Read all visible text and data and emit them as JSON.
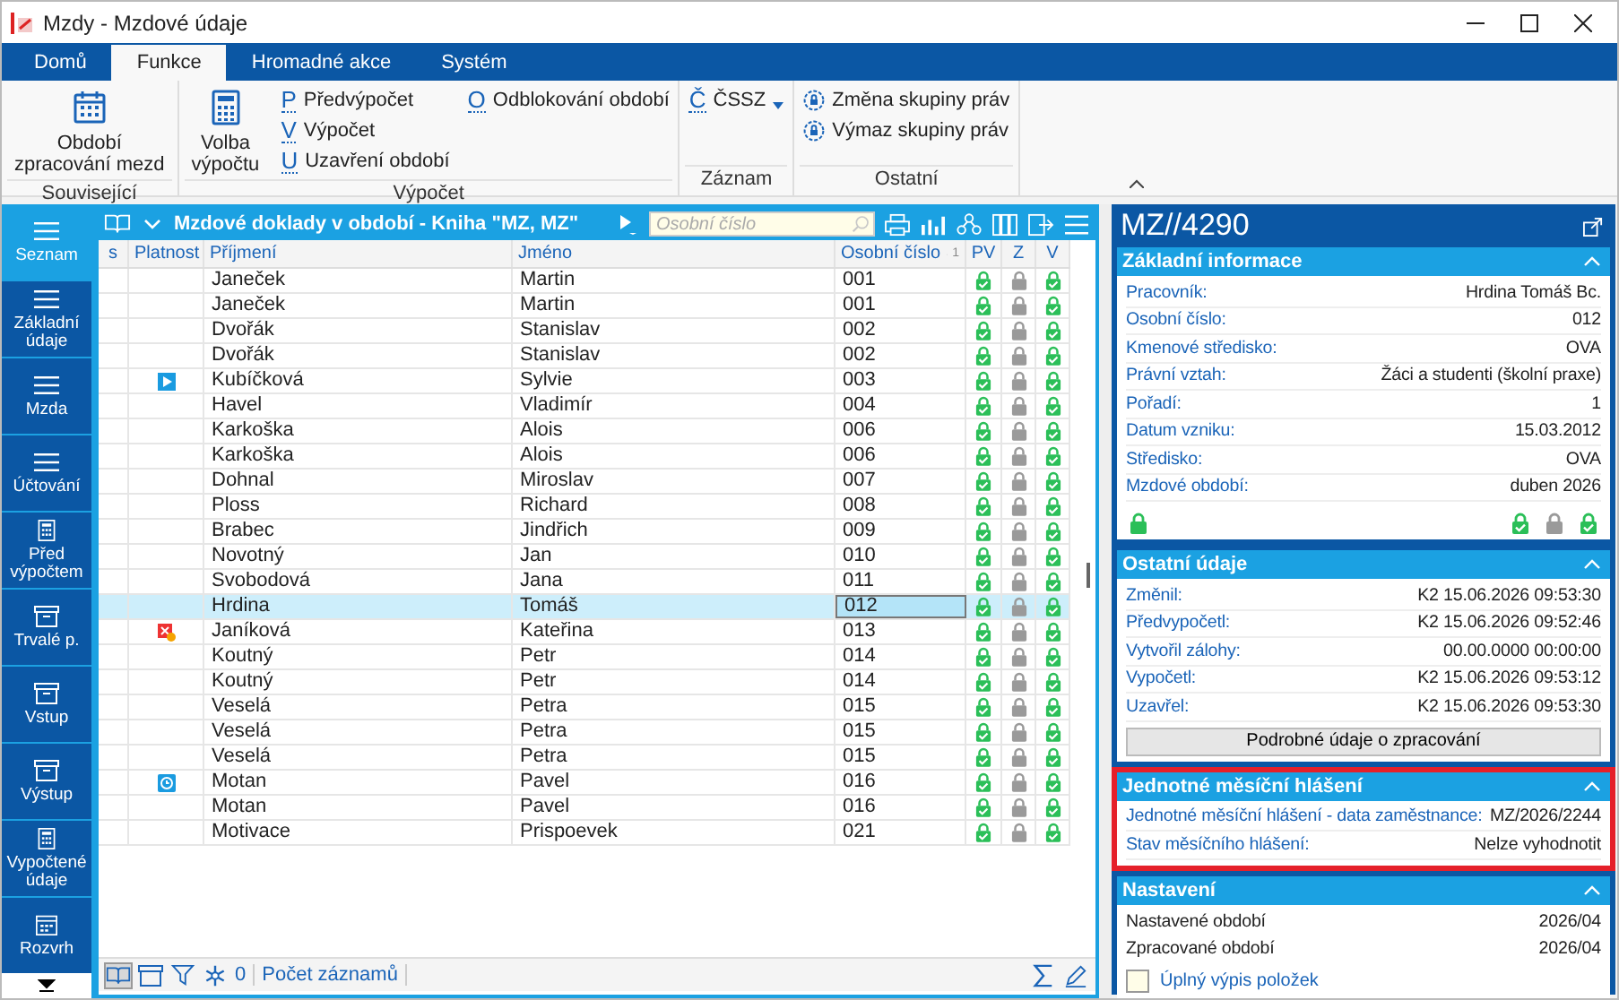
{
  "window": {
    "title": "Mzdy - Mzdové údaje"
  },
  "ribbon": {
    "tabs": [
      {
        "label": "Domů",
        "selected": false
      },
      {
        "label": "Funkce",
        "selected": true
      },
      {
        "label": "Hromadné akce",
        "selected": false
      },
      {
        "label": "Systém",
        "selected": false
      }
    ],
    "groups": [
      {
        "label": "Související",
        "columns": [
          [
            {
              "kind": "calendar",
              "lines": [
                "Období",
                "zpracování mezd"
              ]
            }
          ]
        ]
      },
      {
        "label": "Výpočet",
        "columns": [
          [
            {
              "kind": "calculator",
              "lines": [
                "Volba",
                "výpočtu"
              ]
            }
          ],
          [
            {
              "kind": "letter",
              "key": "P",
              "label": "Předvýpočet"
            },
            {
              "kind": "letter",
              "key": "V",
              "label": "Výpočet"
            },
            {
              "kind": "letter",
              "key": "U",
              "label": "Uzavření období"
            }
          ],
          [
            {
              "kind": "letter",
              "key": "O",
              "label": "Odblokování období"
            }
          ]
        ]
      },
      {
        "label": "Záznam",
        "columns": [
          [
            {
              "kind": "dropdown",
              "key": "Č",
              "label": "ČSSZ"
            }
          ]
        ]
      },
      {
        "label": "Ostatní",
        "columns": [
          [
            {
              "kind": "rights",
              "label": "Změna skupiny práv"
            },
            {
              "kind": "rights",
              "label": "Výmaz skupiny práv"
            }
          ]
        ]
      }
    ]
  },
  "nav": [
    {
      "label": "Seznam",
      "kind": "list",
      "selected": true
    },
    {
      "label": "Základní údaje",
      "kind": "list",
      "selected": false
    },
    {
      "label": "Mzda",
      "kind": "list",
      "selected": false
    },
    {
      "label": "Účtování",
      "kind": "list",
      "selected": false
    },
    {
      "label": "Před výpočtem",
      "kind": "calculator",
      "selected": false
    },
    {
      "label": "Trvalé p.",
      "kind": "box",
      "selected": false
    },
    {
      "label": "Vstup",
      "kind": "box",
      "selected": false
    },
    {
      "label": "Výstup",
      "kind": "box",
      "selected": false
    },
    {
      "label": "Vypočtené údaje",
      "kind": "calculator",
      "selected": false
    },
    {
      "label": "Rozvrh",
      "kind": "calendar",
      "selected": false
    }
  ],
  "table": {
    "title": "Mzdové doklady v období - Kniha \"MZ, MZ\"",
    "search": {
      "placeholder": "Osobní číslo"
    },
    "columns": [
      {
        "label": "s"
      },
      {
        "label": "Platnost"
      },
      {
        "label": "Příjmení"
      },
      {
        "label": "Jméno"
      },
      {
        "label": "Osobní číslo",
        "sort_index": "1"
      },
      {
        "label": "PV"
      },
      {
        "label": "Z"
      },
      {
        "label": "V"
      }
    ],
    "rows": [
      {
        "surname": "Janeček",
        "name": "Martin",
        "number": "001",
        "pv": true,
        "z": false,
        "v": true,
        "selected": false
      },
      {
        "surname": "Janeček",
        "name": "Martin",
        "number": "001",
        "pv": true,
        "z": false,
        "v": true,
        "selected": false
      },
      {
        "surname": "Dvořák",
        "name": "Stanislav",
        "number": "002",
        "pv": true,
        "z": false,
        "v": true,
        "selected": false
      },
      {
        "surname": "Dvořák",
        "name": "Stanislav",
        "number": "002",
        "pv": true,
        "z": false,
        "v": true,
        "selected": false
      },
      {
        "kind": "play",
        "surname": "Kubíčková",
        "name": "Sylvie",
        "number": "003",
        "pv": true,
        "z": false,
        "v": true,
        "selected": false
      },
      {
        "surname": "Havel",
        "name": "Vladimír",
        "number": "004",
        "pv": true,
        "z": false,
        "v": true,
        "selected": false
      },
      {
        "surname": "Karkoška",
        "name": "Alois",
        "number": "006",
        "pv": true,
        "z": false,
        "v": true,
        "selected": false
      },
      {
        "surname": "Karkoška",
        "name": "Alois",
        "number": "006",
        "pv": true,
        "z": false,
        "v": true,
        "selected": false
      },
      {
        "surname": "Dohnal",
        "name": "Miroslav",
        "number": "007",
        "pv": true,
        "z": false,
        "v": true,
        "selected": false
      },
      {
        "surname": "Ploss",
        "name": "Richard",
        "number": "008",
        "pv": true,
        "z": false,
        "v": true,
        "selected": false
      },
      {
        "surname": "Brabec",
        "name": "Jindřich",
        "number": "009",
        "pv": true,
        "z": false,
        "v": true,
        "selected": false
      },
      {
        "surname": "Novotný",
        "name": "Jan",
        "number": "010",
        "pv": true,
        "z": false,
        "v": true,
        "selected": false
      },
      {
        "surname": "Svobodová",
        "name": "Jana",
        "number": "011",
        "pv": true,
        "z": false,
        "v": true,
        "selected": false
      },
      {
        "surname": "Hrdina",
        "name": "Tomáš",
        "number": "012",
        "pv": true,
        "z": false,
        "v": true,
        "selected": true
      },
      {
        "kind": "error",
        "surname": "Janíková",
        "name": "Kateřina",
        "number": "013",
        "pv": true,
        "z": false,
        "v": true,
        "selected": false
      },
      {
        "surname": "Koutný",
        "name": "Petr",
        "number": "014",
        "pv": true,
        "z": false,
        "v": true,
        "selected": false
      },
      {
        "surname": "Koutný",
        "name": "Petr",
        "number": "014",
        "pv": true,
        "z": false,
        "v": true,
        "selected": false
      },
      {
        "surname": "Veselá",
        "name": "Petra",
        "number": "015",
        "pv": true,
        "z": false,
        "v": true,
        "selected": false
      },
      {
        "surname": "Veselá",
        "name": "Petra",
        "number": "015",
        "pv": true,
        "z": false,
        "v": true,
        "selected": false
      },
      {
        "surname": "Veselá",
        "name": "Petra",
        "number": "015",
        "pv": true,
        "z": false,
        "v": true,
        "selected": false
      },
      {
        "kind": "clock",
        "surname": "Motan",
        "name": "Pavel",
        "number": "016",
        "pv": true,
        "z": false,
        "v": true,
        "selected": false
      },
      {
        "surname": "Motan",
        "name": "Pavel",
        "number": "016",
        "pv": true,
        "z": false,
        "v": true,
        "selected": false
      },
      {
        "surname": "Motivace",
        "name": "Prispoevek",
        "number": "021",
        "pv": true,
        "z": false,
        "v": true,
        "selected": false
      }
    ],
    "footer": {
      "count": "0",
      "label": "Počet záznamů"
    }
  },
  "detail": {
    "title": "MZ//4290",
    "sections": [
      {
        "kind": "info",
        "title": "Základní informace",
        "highlighted": false,
        "fields": [
          {
            "label": "Pracovník:",
            "value": "Hrdina Tomáš Bc."
          },
          {
            "label": "Osobní číslo:",
            "value": "012"
          },
          {
            "label": "Kmenové středisko:",
            "value": "OVA"
          },
          {
            "label": "Právní vztah:",
            "value": "Žáci a studenti (školní praxe)"
          },
          {
            "label": "Pořadí:",
            "value": "1"
          },
          {
            "label": "Datum vzniku:",
            "value": "15.03.2012"
          },
          {
            "label": "Středisko:",
            "value": "OVA"
          },
          {
            "label": "Mzdové období:",
            "value": "duben 2026"
          }
        ],
        "locks": [
          {
            "kind": "open"
          },
          {
            "kind": "check"
          },
          {
            "kind": "grey"
          },
          {
            "kind": "check"
          }
        ]
      },
      {
        "kind": "info",
        "title": "Ostatní údaje",
        "highlighted": false,
        "fields": [
          {
            "label": "Změnil:",
            "value": "K2 15.06.2026 09:53:30"
          },
          {
            "label": "Předvypočetl:",
            "value": "K2 15.06.2026 09:52:46"
          },
          {
            "label": "Vytvořil zálohy:",
            "value": "00.00.0000 00:00:00"
          },
          {
            "label": "Vypočetl:",
            "value": "K2 15.06.2026 09:53:12"
          },
          {
            "label": "Uzavřel:",
            "value": "K2 15.06.2026 09:53:30"
          }
        ],
        "button": "Podrobné údaje o zpracování"
      },
      {
        "kind": "info",
        "title": "Jednotné měsíční hlášení",
        "highlighted": true,
        "fields": [
          {
            "label": "Jednotné měsíční hlášení - data zaměstnance:",
            "value": "MZ/2026/2244"
          },
          {
            "label": "Stav měsíčního hlášení:",
            "value": "Nelze vyhodnotit"
          }
        ]
      },
      {
        "kind": "settings",
        "title": "Nastavení",
        "highlighted": false,
        "fields": [
          {
            "label": "Nastavené období",
            "value": "2026/04"
          },
          {
            "label": "Zpracované období",
            "value": "2026/04"
          }
        ],
        "checkbox": {
          "label": "Úplný výpis položek",
          "checked": false
        }
      }
    ]
  }
}
